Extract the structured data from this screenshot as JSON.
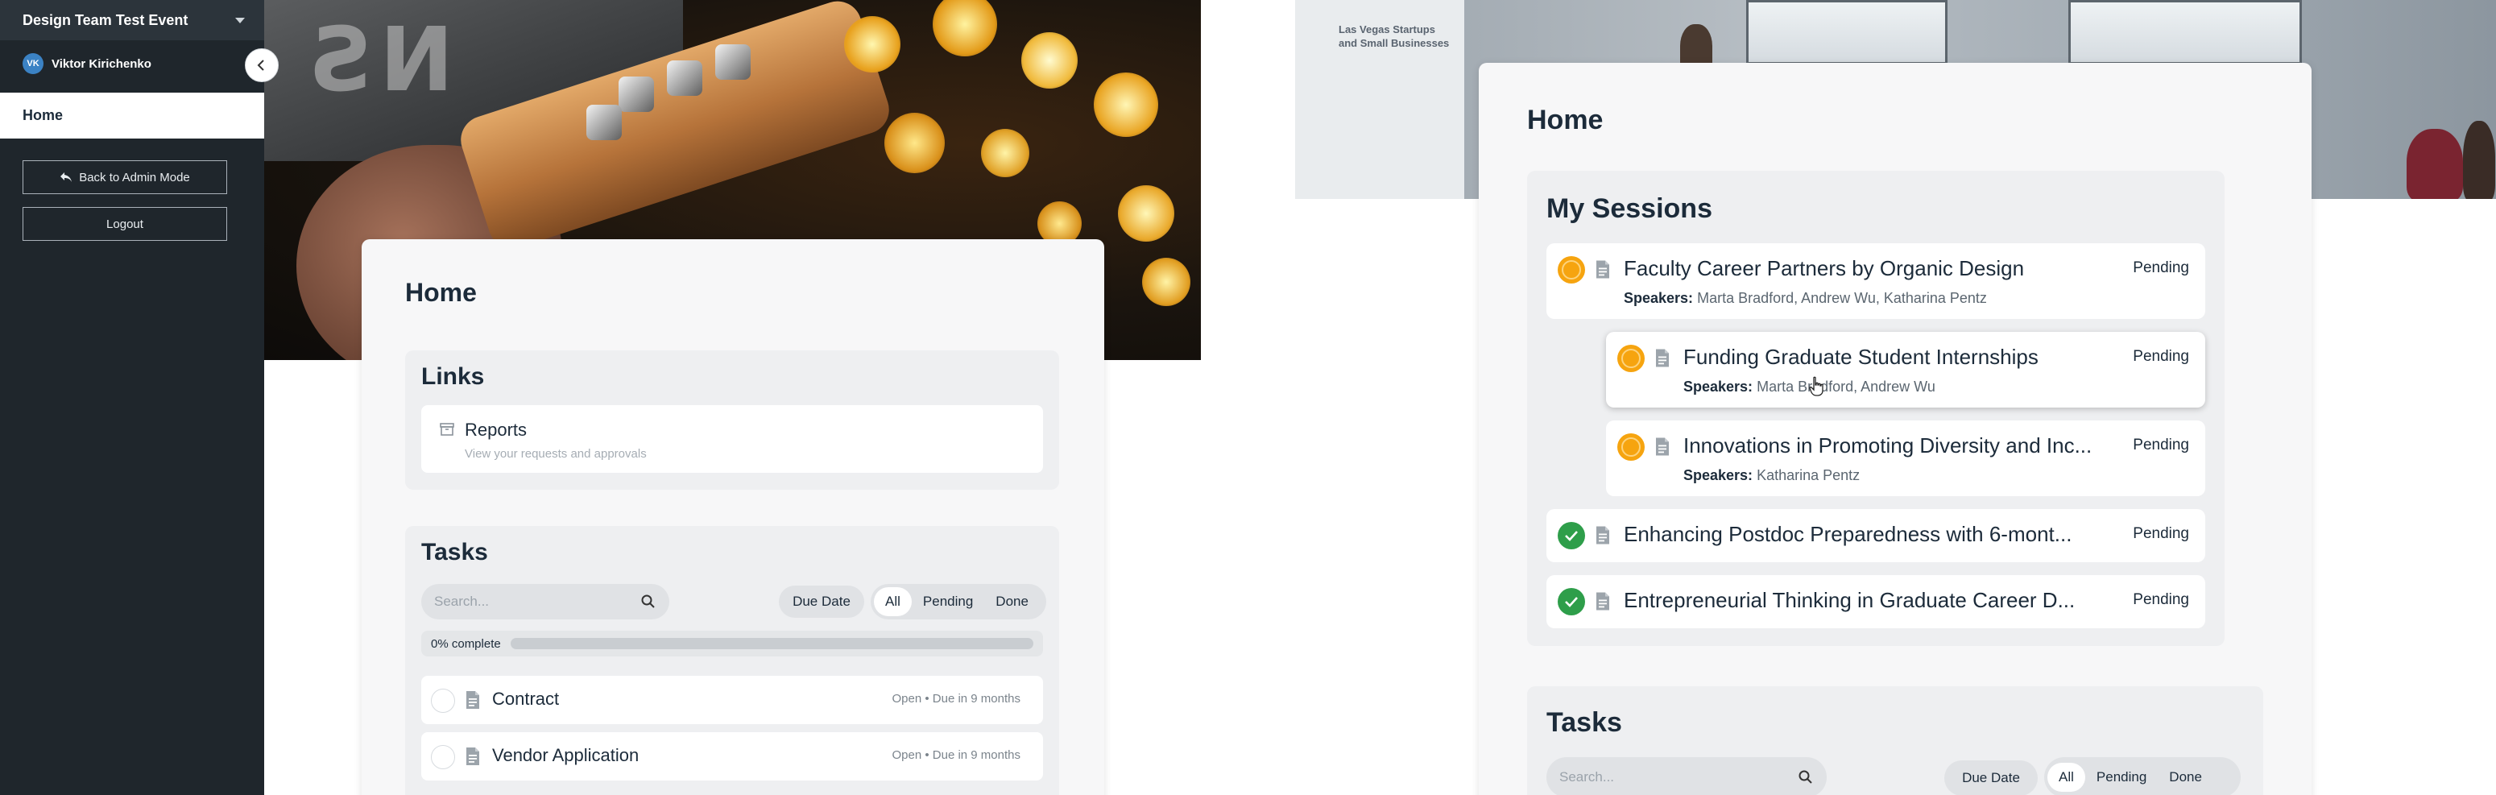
{
  "sidebar": {
    "event_title": "Design Team Test Event",
    "user": {
      "initials": "VK",
      "name": "Viktor Kirichenko"
    },
    "nav_home": "Home",
    "back_label": "Back to Admin Mode",
    "logout_label": "Logout"
  },
  "left_card": {
    "home_title": "Home",
    "links": {
      "title": "Links",
      "items": [
        {
          "title": "Reports",
          "subtitle": "View your requests and approvals"
        }
      ]
    },
    "tasks": {
      "title": "Tasks",
      "search_placeholder": "Search...",
      "sort_label": "Due Date",
      "filters": [
        "All",
        "Pending",
        "Done"
      ],
      "active_filter": "All",
      "progress_label": "0% complete",
      "progress": 0,
      "items": [
        {
          "name": "Contract",
          "meta": "Open • Due in 9 months"
        },
        {
          "name": "Vendor Application",
          "meta": "Open • Due in 9 months"
        }
      ]
    }
  },
  "hero_right": {
    "projector_title": "Las Vegas Startups and Small Businesses"
  },
  "right_card": {
    "home_title": "Home",
    "sessions": {
      "title": "My Sessions",
      "speakers_label": "Speakers:",
      "items": [
        {
          "name": "Faculty Career Partners by Organic Design",
          "speakers": "Marta Bradford, Andrew Wu, Katharina Pentz",
          "status": "Pending",
          "state": "pending"
        },
        {
          "name": "Funding Graduate Student Internships",
          "speakers": "Marta Bradford, Andrew Wu",
          "status": "Pending",
          "state": "pending"
        },
        {
          "name": "Innovations in Promoting Diversity and Inc...",
          "speakers": "Katharina Pentz",
          "status": "Pending",
          "state": "pending"
        },
        {
          "name": "Enhancing Postdoc Preparedness with 6-mont...",
          "speakers": "",
          "status": "Pending",
          "state": "done"
        },
        {
          "name": "Entrepreneurial Thinking in Graduate Career D...",
          "speakers": "",
          "status": "Pending",
          "state": "done"
        }
      ]
    },
    "tasks": {
      "title": "Tasks",
      "search_placeholder": "Search...",
      "sort_label": "Due Date",
      "filters": [
        "All",
        "Pending",
        "Done"
      ],
      "active_filter": "All"
    }
  },
  "colors": {
    "sidebar_bg": "#1f262c",
    "pending": "#f6a40f",
    "done": "#2e9e4a",
    "text": "#1c2b3a"
  }
}
